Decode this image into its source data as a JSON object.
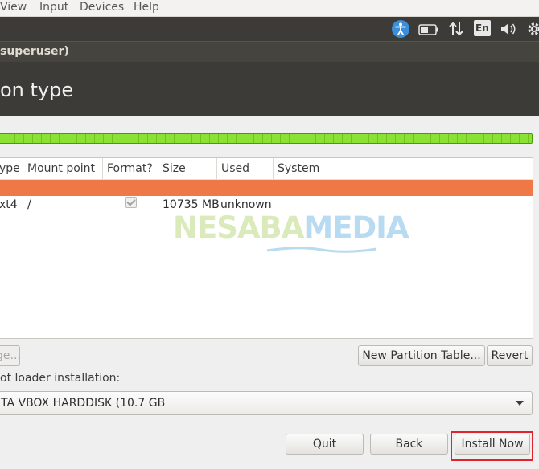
{
  "menubar": {
    "items": [
      "View",
      "Input",
      "Devices",
      "Help"
    ]
  },
  "panel": {
    "icons": [
      "accessibility-icon",
      "battery-icon",
      "network-arrows-icon",
      "keyboard-layout-indicator",
      "volume-icon",
      "settings-gear-icon"
    ],
    "keyboard_layout": "En"
  },
  "window": {
    "title": "superuser)"
  },
  "banner": {
    "heading": "on type"
  },
  "colors": {
    "progress": "#8ae234",
    "selection": "#f07746",
    "highlight_outline": "#e0242d",
    "panel_bg": "#3c3b37"
  },
  "table": {
    "columns": [
      "ype",
      "Mount point",
      "Format?",
      "Size",
      "Used",
      "System"
    ],
    "rows": [
      {
        "type": "",
        "mount": "",
        "format": "",
        "size": "",
        "used": "",
        "system": "",
        "selected": true
      },
      {
        "type": "xt4",
        "mount": "/",
        "format": "checked",
        "size": "10735 MB",
        "used": "unknown",
        "system": "",
        "selected": false
      }
    ]
  },
  "watermark": {
    "text_a": "NESABA",
    "text_b": "MEDIA"
  },
  "buttons": {
    "change": "ge...",
    "new_partition_table": "New Partition Table...",
    "revert": "Revert",
    "quit": "Quit",
    "back": "Back",
    "install_now": "Install Now"
  },
  "bootloader": {
    "label": "ot loader installation:",
    "device": "TA VBOX HARDDISK (10.7 GB"
  }
}
